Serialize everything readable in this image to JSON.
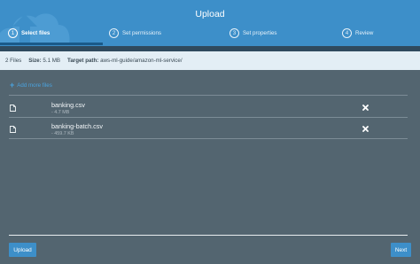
{
  "header": {
    "title": "Upload",
    "steps": [
      {
        "num": "1",
        "label": "Select files",
        "active": true
      },
      {
        "num": "2",
        "label": "Set permissions",
        "active": false
      },
      {
        "num": "3",
        "label": "Set properties",
        "active": false
      },
      {
        "num": "4",
        "label": "Review",
        "active": false
      }
    ]
  },
  "info": {
    "file_count": "2 Files",
    "size_label": "Size:",
    "size_value": "5.1 MB",
    "path_label": "Target path:",
    "path_value": "aws-ml-guide/amazon-ml-service/"
  },
  "add_more_label": "Add more files",
  "files": [
    {
      "name": "banking.csv",
      "size": "- 4.7 MB",
      "icon": "file-icon"
    },
    {
      "name": "banking-batch.csv",
      "size": "- 459.7 KB",
      "icon": "file-icon"
    }
  ],
  "buttons": {
    "upload": "Upload",
    "next": "Next"
  },
  "colors": {
    "header_bg": "#3d8fc9",
    "panel_bg": "#536570",
    "accent": "#4aa3df",
    "info_bg": "#e3eef5"
  }
}
